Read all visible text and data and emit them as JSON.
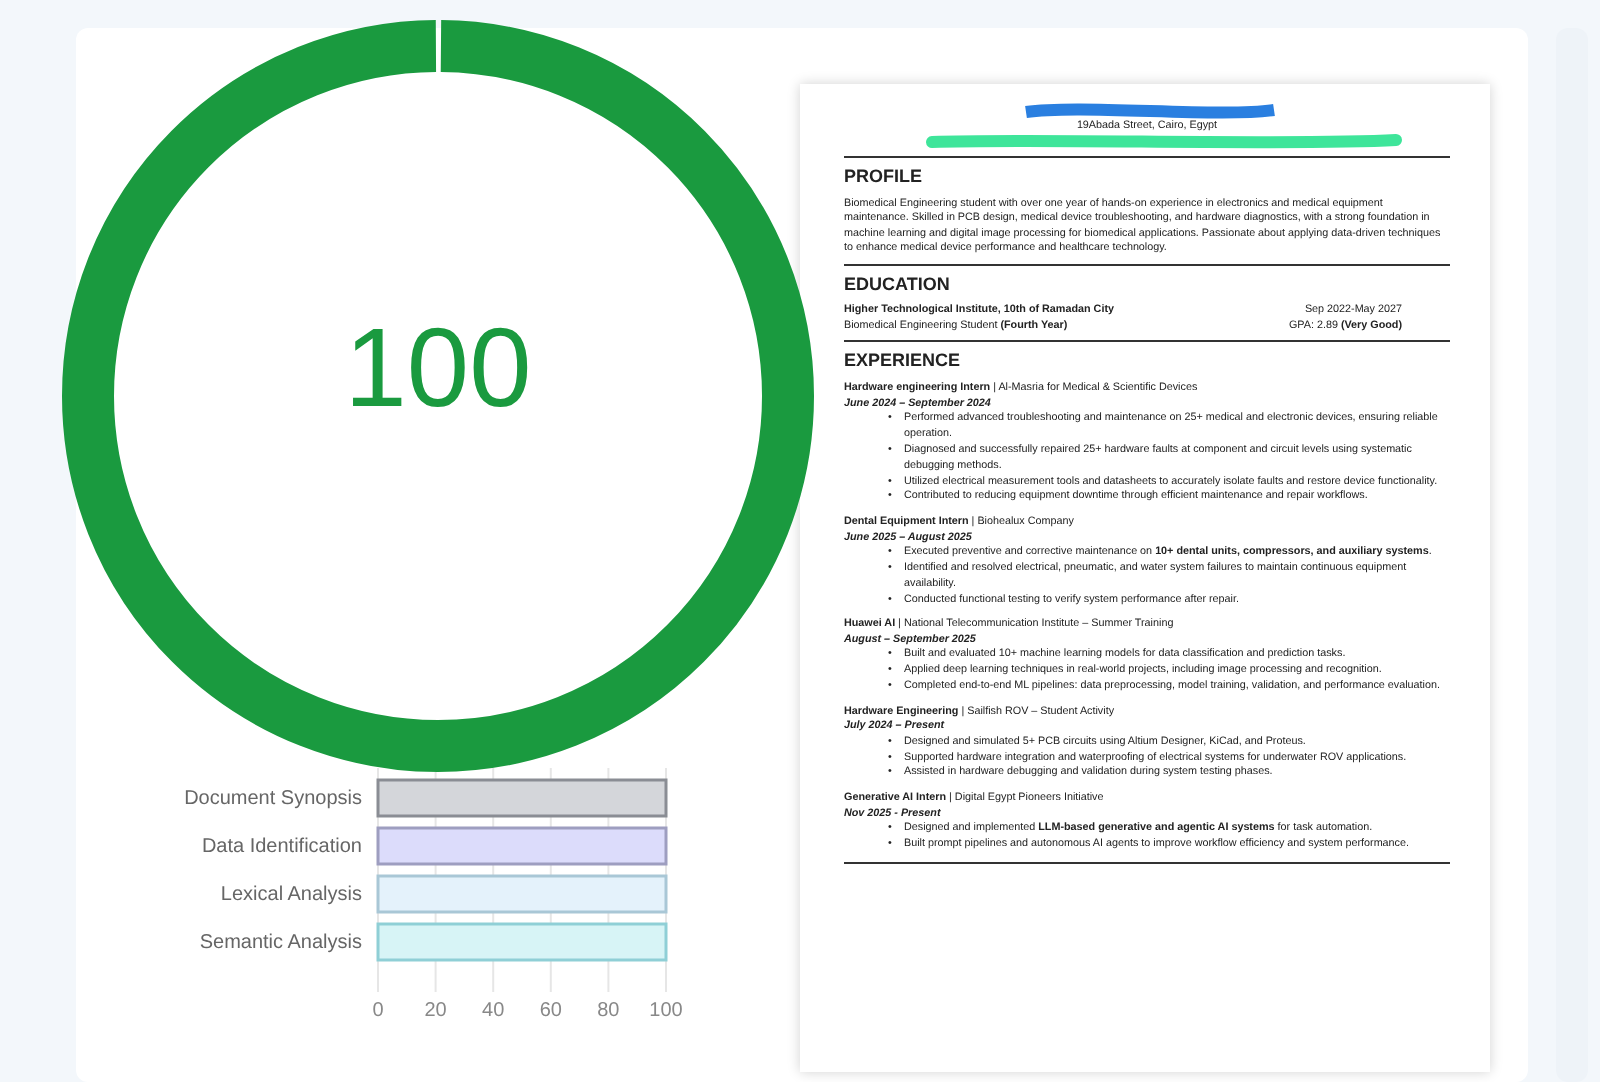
{
  "score": {
    "value": "100",
    "level": 1
  },
  "sections_chart": {
    "chart_data": {
      "type": "bar",
      "orientation": "horizontal",
      "categories": [
        "Document Synopsis",
        "Data Identification",
        "Lexical Analysis",
        "Semantic Analysis"
      ],
      "series": [
        {
          "values": [
            100,
            100,
            100,
            100
          ]
        }
      ],
      "grid": true,
      "xlim": [
        0,
        100
      ],
      "xticks": [
        0,
        20,
        40,
        60,
        80,
        100
      ]
    }
  },
  "resume": {
    "address": "19Abada Street, Cairo, Egypt",
    "profile": {
      "heading": "PROFILE",
      "text": "Biomedical Engineering student with over one year of hands-on experience in electronics and medical equipment maintenance. Skilled in PCB design, medical device troubleshooting, and hardware diagnostics, with a strong foundation in machine learning and digital image processing for biomedical applications. Passionate about applying data-driven techniques to enhance medical device performance and healthcare technology."
    },
    "education": {
      "heading": "EDUCATION",
      "school": "Higher Technological Institute, 10th of Ramadan City",
      "dates": "Sep 2022-May 2027",
      "degree": "Biomedical Engineering Student  **(Fourth Year)**",
      "gpa": "GPA: 2.89 **(Very Good)**"
    },
    "experience": {
      "heading": "EXPERIENCE",
      "bullet_marker": "•",
      "entries": [
        {
          "title": "**Hardware engineering Intern** | Al-Masria for Medical & Scientific Devices",
          "dates": "June 2024 – September 2024",
          "bullets": [
            "Performed advanced troubleshooting and maintenance on 25+ medical and electronic devices, ensuring reliable operation.",
            "Diagnosed and successfully repaired 25+ hardware faults at component and circuit levels using systematic debugging methods.",
            "Utilized electrical measurement tools and datasheets to accurately isolate faults and restore device functionality.",
            "Contributed to reducing equipment downtime through efficient maintenance and repair workflows."
          ]
        },
        {
          "title": "**Dental Equipment Intern** | Biohealux Company",
          "dates": "June 2025 – August 2025",
          "bullets": [
            "Executed preventive and corrective maintenance on **10+ dental units, compressors, and auxiliary systems**.",
            "Identified and resolved electrical, pneumatic, and water system failures to maintain continuous equipment availability.",
            "Conducted functional testing to verify system performance after repair."
          ]
        },
        {
          "title": "**Huawei AI** | National Telecommunication Institute – Summer Training",
          "dates": "August – September 2025",
          "bullets": [
            "Built and evaluated 10+ machine learning models for data classification and prediction tasks.",
            "Applied deep learning techniques in real-world projects, including image processing and recognition.",
            "Completed end-to-end ML pipelines: data preprocessing, model training, validation, and performance evaluation."
          ]
        },
        {
          "title": "**Hardware Engineering** | Sailfish ROV – Student Activity",
          "dates": "July 2024 – Present",
          "bullets": [
            "Designed and simulated 5+ PCB circuits using Altium Designer, KiCad, and Proteus.",
            "Supported hardware integration and waterproofing of electrical systems for underwater ROV applications.",
            "Assisted in hardware debugging and validation during system testing phases."
          ]
        },
        {
          "title": "**Generative AI Intern** | Digital Egypt Pioneers Initiative",
          "dates": " Nov 2025 - Present",
          "bullets": [
            "Designed and implemented **LLM-based generative and agentic AI systems** for task automation.",
            "Built prompt pipelines and autonomous AI agents to improve workflow efficiency and system performance."
          ]
        }
      ]
    }
  }
}
